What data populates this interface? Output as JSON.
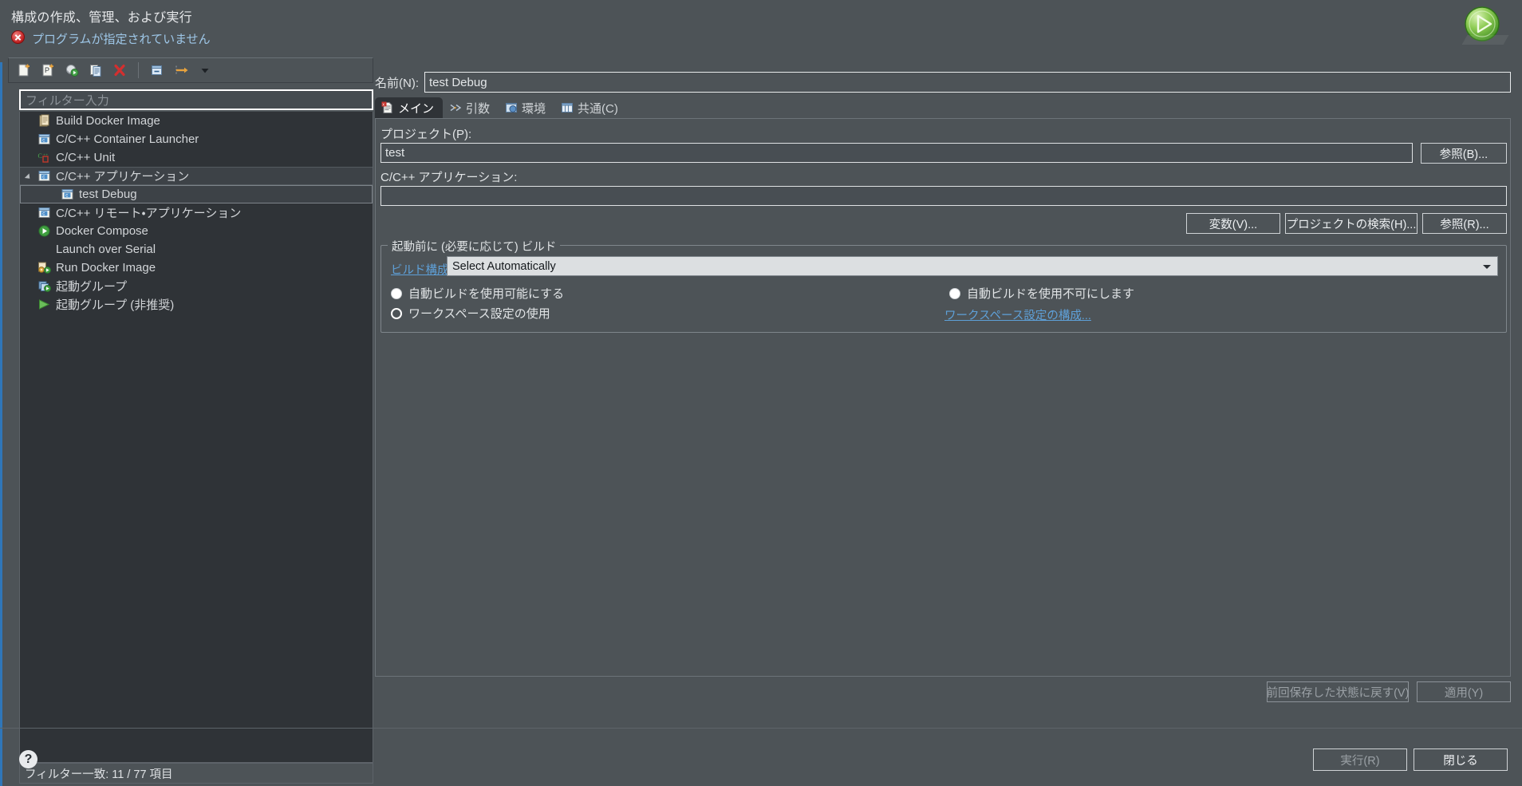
{
  "header": {
    "title": "構成の作成、管理、および実行",
    "status_message": "プログラムが指定されていません",
    "error_icon": "error-icon",
    "run_icon": "run-launch-icon"
  },
  "toolbar": {
    "buttons": [
      {
        "name": "new-configuration",
        "icon": "new-file-icon"
      },
      {
        "name": "new-prototype",
        "icon": "new-prototype-icon"
      },
      {
        "name": "export-configuration",
        "icon": "export-icon"
      },
      {
        "name": "duplicate-configuration",
        "icon": "duplicate-icon"
      },
      {
        "name": "delete-configuration",
        "icon": "delete-x-icon"
      },
      {
        "name": "collapse-all",
        "icon": "collapse-all-icon"
      },
      {
        "name": "filter-configurations",
        "icon": "filter-arrow-icon"
      },
      {
        "name": "toolbar-menu",
        "icon": "chevron-down-icon"
      }
    ]
  },
  "filter": {
    "placeholder": "フィルター入力",
    "value": ""
  },
  "tree": {
    "items": [
      {
        "label": "Build Docker Image",
        "icon": "docker-build-icon",
        "indent": 0,
        "selected": false,
        "expandable": false
      },
      {
        "label": "C/C++ Container Launcher",
        "icon": "c-launcher-icon",
        "indent": 0,
        "selected": false,
        "expandable": false
      },
      {
        "label": "C/C++ Unit",
        "icon": "cpp-unit-icon",
        "indent": 0,
        "selected": false,
        "expandable": false
      },
      {
        "label": "C/C++ アプリケーション",
        "icon": "c-application-icon",
        "indent": 0,
        "selected": "parent",
        "expandable": true
      },
      {
        "label": "test Debug",
        "icon": "c-application-icon",
        "indent": 1,
        "selected": "child",
        "expandable": false
      },
      {
        "label": "C/C++ リモート・アプリケーション",
        "icon": "c-remote-icon",
        "indent": 0,
        "selected": false,
        "expandable": false
      },
      {
        "label": "Docker Compose",
        "icon": "docker-compose-run-icon",
        "indent": 0,
        "selected": false,
        "expandable": false
      },
      {
        "label": "Launch over Serial",
        "icon": "none",
        "indent": 0,
        "selected": false,
        "expandable": false
      },
      {
        "label": "Run Docker Image",
        "icon": "docker-run-icon",
        "indent": 0,
        "selected": false,
        "expandable": false
      },
      {
        "label": "起動グループ",
        "icon": "launch-group-icon",
        "indent": 0,
        "selected": false,
        "expandable": false
      },
      {
        "label": "起動グループ (非推奨)",
        "icon": "launch-group-deprecated-icon",
        "indent": 0,
        "selected": false,
        "expandable": false
      }
    ],
    "status": "フィルター一致: 11 / 77 項目"
  },
  "config": {
    "name_label": "名前(N):",
    "name_value": "test Debug",
    "tabs": [
      {
        "label": "メイン",
        "icon": "main-tab-icon",
        "active": true
      },
      {
        "label": "引数",
        "icon": "arguments-tab-icon",
        "active": false
      },
      {
        "label": "環境",
        "icon": "environment-tab-icon",
        "active": false
      },
      {
        "label": "共通(C)",
        "icon": "common-tab-icon",
        "active": false
      }
    ],
    "project_label": "プロジェクト(P):",
    "project_value": "test",
    "app_label": "C/C++ アプリケーション:",
    "app_value": "",
    "browse_project_button": "参照(B)...",
    "variables_button": "変数(V)...",
    "search_project_button": "プロジェクトの検索(H)...",
    "browse_app_button": "参照(R)...",
    "build_group_title": "起動前に (必要に応じて) ビルド",
    "build_config_link": "ビルド構成:",
    "build_config_value": "Select Automatically",
    "radio_enable_autobuild": "自動ビルドを使用可能にする",
    "radio_disable_autobuild": "自動ビルドを使用不可にします",
    "radio_workspace_settings": "ワークスペース設定の使用",
    "workspace_settings_link": "ワークスペース設定の構成...",
    "revert_button": "前回保存した状態に戻す(V)",
    "apply_button": "適用(Y)"
  },
  "footer": {
    "help_icon": "help-question-icon",
    "run_button": "実行(R)",
    "close_button": "閉じる"
  },
  "colors": {
    "background": "#4d5357",
    "tree_background": "#2f3337",
    "accent_link": "#5ea0d8",
    "status_text": "#9ec7e8",
    "border": "#7f868c"
  }
}
